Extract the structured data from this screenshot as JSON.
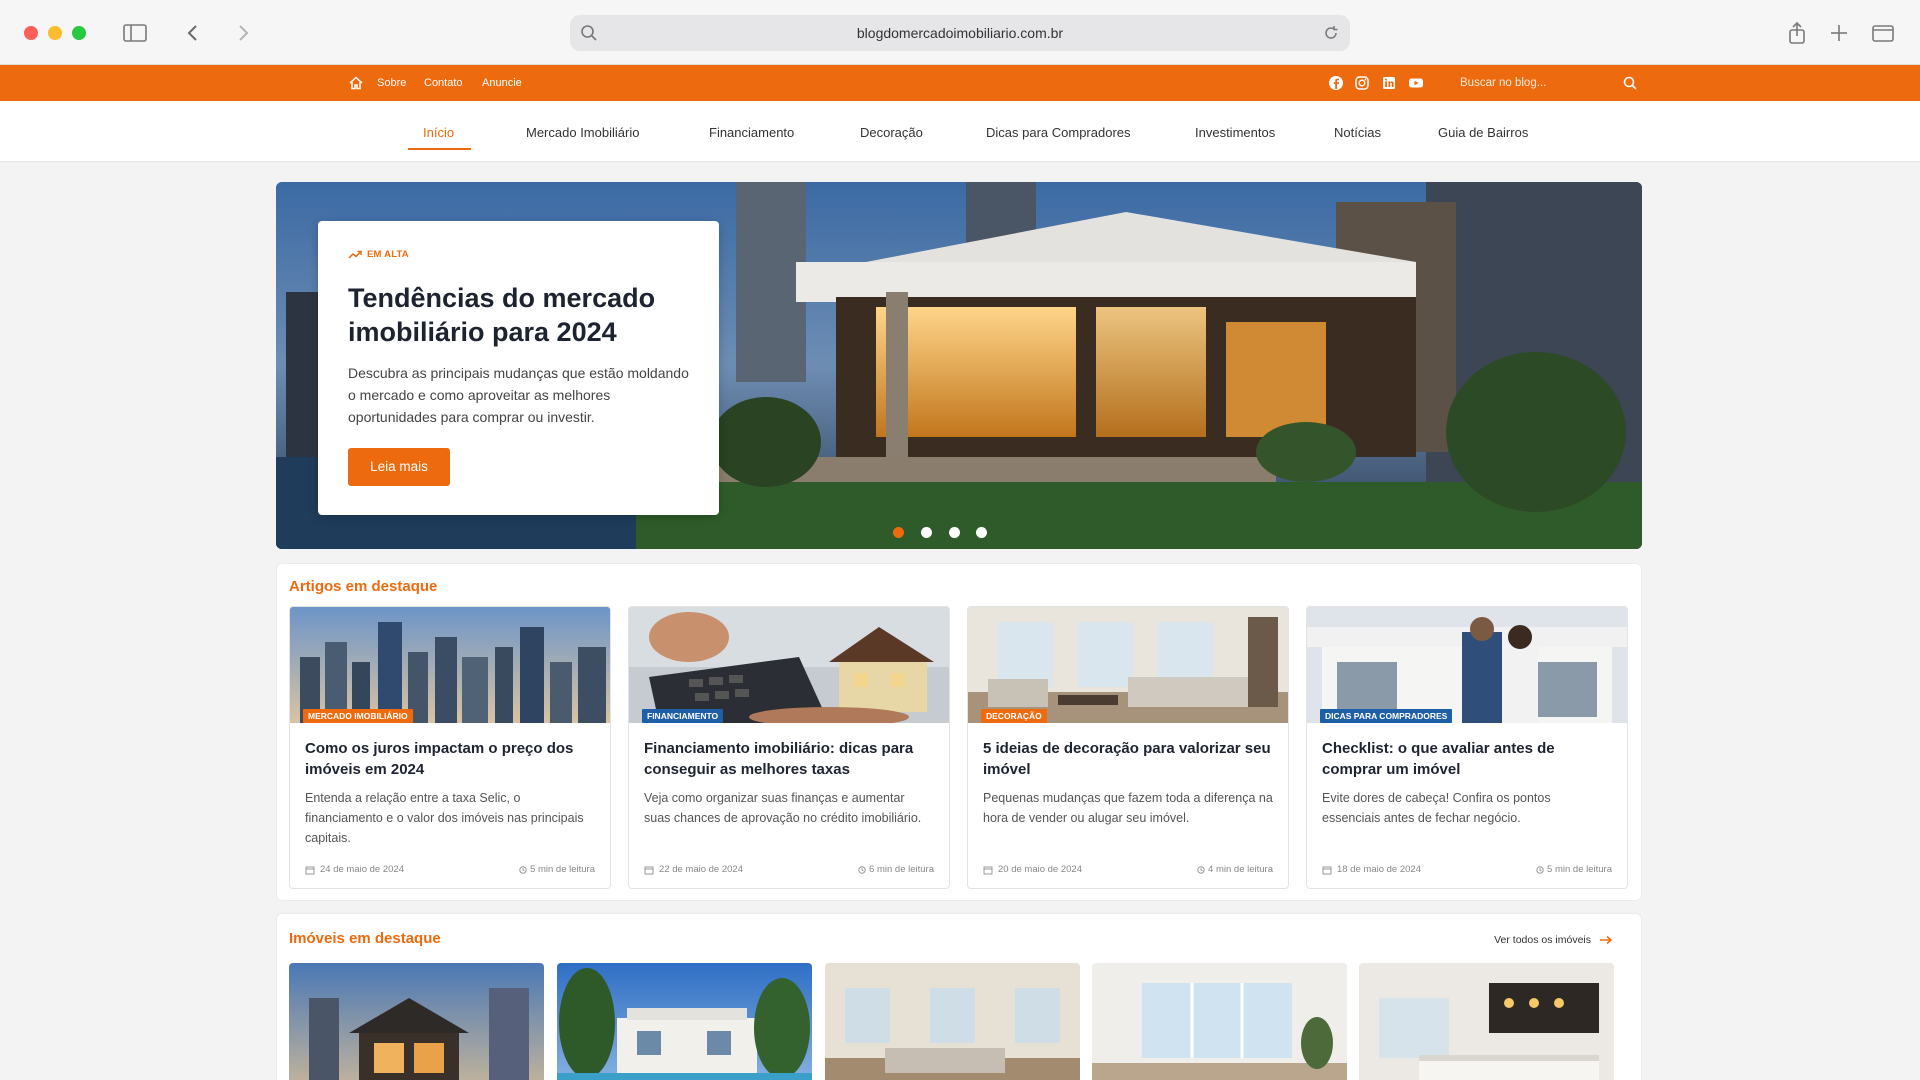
{
  "browser": {
    "url": "blogdomercadoimobiliario.com.br"
  },
  "topbar": {
    "links": [
      "Sobre",
      "Contato",
      "Anuncie"
    ],
    "search_placeholder": "Buscar no blog...",
    "social_icons": [
      "facebook-icon",
      "instagram-icon",
      "linkedin-icon",
      "youtube-icon"
    ]
  },
  "nav": {
    "items": [
      "Início",
      "Mercado Imobiliário",
      "Financiamento",
      "Decoração",
      "Dicas para Compradores",
      "Investimentos",
      "Notícias",
      "Guia de Bairros"
    ],
    "active": "Início"
  },
  "hero": {
    "tag": "EM ALTA",
    "title": "Tendências do mercado imobiliário para 2024",
    "description": "Descubra as principais mudanças que estão moldando o mercado e como aproveitar as melhores oportunidades para comprar ou investir.",
    "button": "Leia mais",
    "slides_count": 4,
    "active_slide": 1
  },
  "featured_articles": {
    "title": "Artigos em destaque",
    "items": [
      {
        "category": "MERCADO IMOBILIÁRIO",
        "category_color": "#ee6a0e",
        "title": "Como os juros impactam o preço dos imóveis em 2024",
        "description": "Entenda a relação entre a taxa Selic, o financiamento e o valor dos imóveis nas principais capitais.",
        "date": "24 de maio de 2024",
        "read_time": "5 min de leitura"
      },
      {
        "category": "FINANCIAMENTO",
        "category_color": "#1e5fa8",
        "title": "Financiamento imobiliário: dicas para conseguir as melhores taxas",
        "description": "Veja como organizar suas finanças e aumentar suas chances de aprovação no crédito imobiliário.",
        "date": "22 de maio de 2024",
        "read_time": "6 min de leitura"
      },
      {
        "category": "DECORAÇÃO",
        "category_color": "#ee6a0e",
        "title": "5 ideias de decoração para valorizar seu imóvel",
        "description": "Pequenas mudanças que fazem toda a diferença na hora de vender ou alugar seu imóvel.",
        "date": "20 de maio de 2024",
        "read_time": "4 min de leitura"
      },
      {
        "category": "DICAS PARA COMPRADORES",
        "category_color": "#1e5fa8",
        "title": "Checklist: o que avaliar antes de comprar um imóvel",
        "description": "Evite dores de cabeça! Confira os pontos essenciais antes de fechar negócio.",
        "date": "18 de maio de 2024",
        "read_time": "5 min de leitura"
      }
    ]
  },
  "featured_properties": {
    "title": "Imóveis em destaque",
    "see_all": "Ver todos os imóveis"
  },
  "colors": {
    "accent": "#ee6a0e",
    "blue_tag": "#1e5fa8"
  }
}
